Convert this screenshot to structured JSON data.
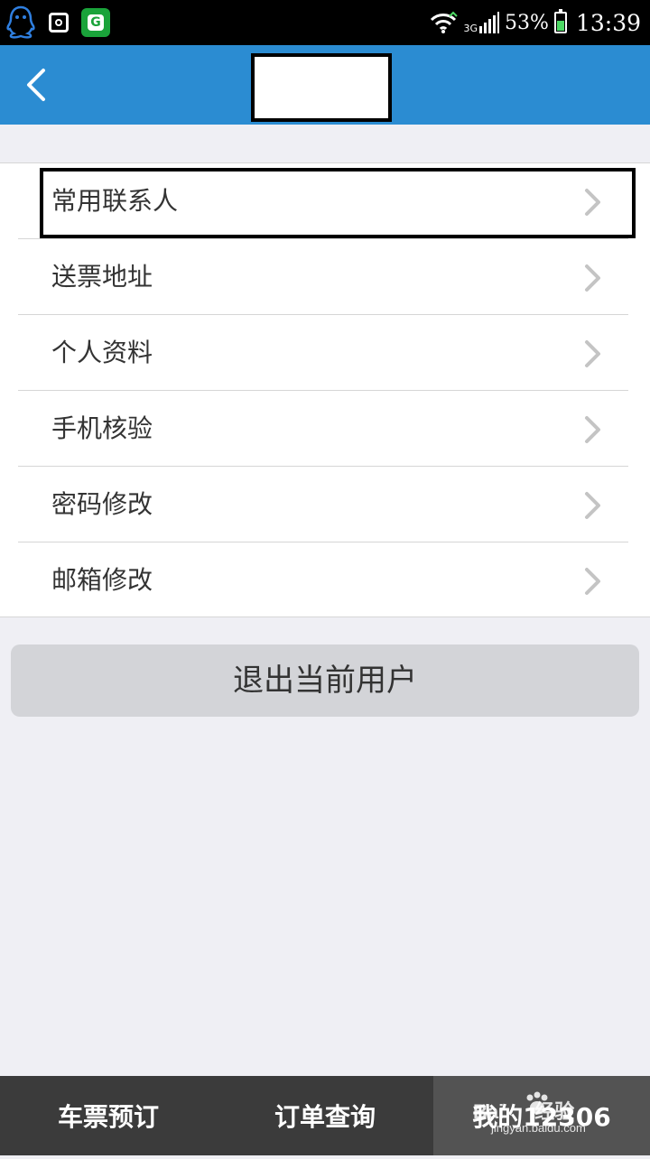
{
  "status_bar": {
    "network": "3G",
    "battery_percent": "53%",
    "time": "13:39",
    "icons": [
      "qq-icon",
      "screenshot-icon",
      "green-app-icon",
      "wifi-icon",
      "signal-icon",
      "battery-icon"
    ]
  },
  "nav": {
    "back_icon": "chevron-left-icon",
    "title": ""
  },
  "menu": {
    "items": [
      {
        "label": "常用联系人"
      },
      {
        "label": "送票地址"
      },
      {
        "label": "个人资料"
      },
      {
        "label": "手机核验"
      },
      {
        "label": "密码修改"
      },
      {
        "label": "邮箱修改"
      }
    ]
  },
  "logout": {
    "label": "退出当前用户"
  },
  "tabs": [
    {
      "label": "车票预订",
      "active": false
    },
    {
      "label": "订单查询",
      "active": false
    },
    {
      "label": "我的12306",
      "active": true
    }
  ],
  "watermark": {
    "brand": "Bai",
    "brand2": "经验",
    "url": "jingyan.baidu.com"
  },
  "colors": {
    "nav_blue": "#2b8cd2",
    "background": "#efeff4",
    "tab_bar": "#3b3b3b",
    "tab_active": "#535353",
    "logout_bg": "#d3d4d8"
  }
}
